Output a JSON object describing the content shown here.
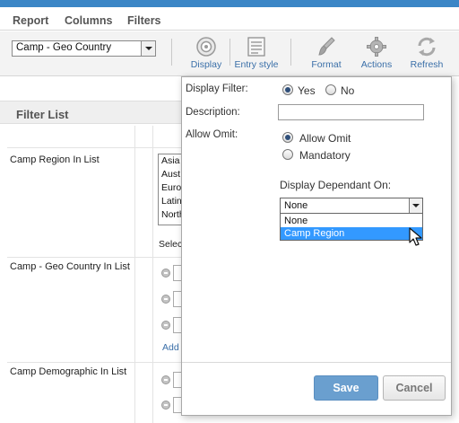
{
  "menu": {
    "report": "Report",
    "columns": "Columns",
    "filters": "Filters"
  },
  "toolbar": {
    "selected_dimension": "Camp - Geo Country",
    "display": "Display",
    "entry_style": "Entry style",
    "format": "Format",
    "actions": "Actions",
    "refresh": "Refresh"
  },
  "filter_list": {
    "title": "Filter List",
    "rows": [
      {
        "label": "Camp Region In List"
      },
      {
        "label": "Camp - Geo Country In List"
      },
      {
        "label": "Camp Demographic In List"
      }
    ],
    "region_options_partial": [
      "Asia",
      "Aust",
      "Euro",
      "Latin",
      "North"
    ],
    "select_partial": "Selec",
    "add_partial": "Add"
  },
  "popup": {
    "display_filter_label": "Display Filter:",
    "yes": "Yes",
    "no": "No",
    "display_filter_value": "Yes",
    "description_label": "Description:",
    "description_value": "",
    "allow_omit_label": "Allow Omit:",
    "allow_omit_option": "Allow Omit",
    "mandatory_option": "Mandatory",
    "allow_omit_value": "Allow Omit",
    "dependant_label": "Display Dependant On:",
    "dependant_selected": "None",
    "dependant_options": [
      "None",
      "Camp Region"
    ],
    "dependant_highlighted": "Camp Region",
    "save": "Save",
    "cancel": "Cancel"
  },
  "colors": {
    "accent": "#3b86c6",
    "link": "#3a6fa8",
    "save_button": "#6a9fcf",
    "highlight": "#3399ff"
  }
}
